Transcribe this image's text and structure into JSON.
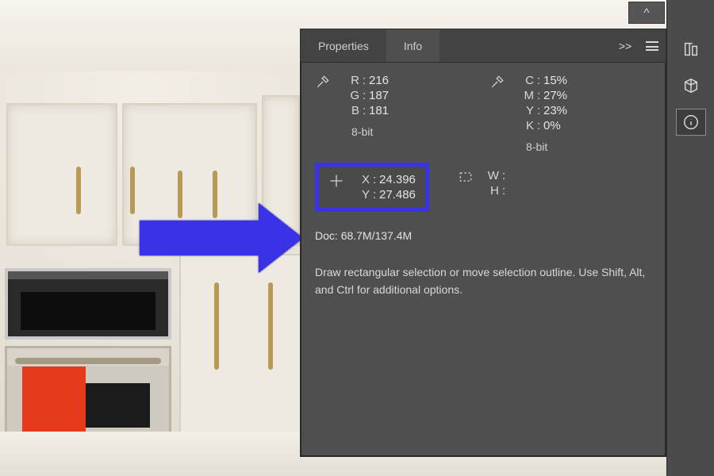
{
  "tabs": {
    "properties": "Properties",
    "info": "Info"
  },
  "panel_buttons": {
    "more": ">>",
    "collapse": "^"
  },
  "colors": {
    "rgb": {
      "r_label": "R",
      "g_label": "G",
      "b_label": "B",
      "r": "216",
      "g": "187",
      "b": "181",
      "depth": "8-bit"
    },
    "cmyk": {
      "c_label": "C",
      "m_label": "M",
      "y_label": "Y",
      "k_label": "K",
      "c": "15%",
      "m": "27%",
      "y": "23%",
      "k": "0%",
      "depth": "8-bit"
    }
  },
  "position": {
    "x_label": "X",
    "y_label": "Y",
    "x": "24.396",
    "y": "27.486"
  },
  "dimensions": {
    "w_label": "W",
    "h_label": "H",
    "w": "",
    "h": ""
  },
  "doc": {
    "prefix": "Doc:",
    "value": "68.7M/137.4M"
  },
  "hint": "Draw rectangular selection or move selection outline.  Use Shift, Alt, and Ctrl for additional options.",
  "dock_icons": {
    "collapse": "^",
    "align": "align-icon",
    "cube": "cube-icon",
    "info": "info-icon"
  }
}
